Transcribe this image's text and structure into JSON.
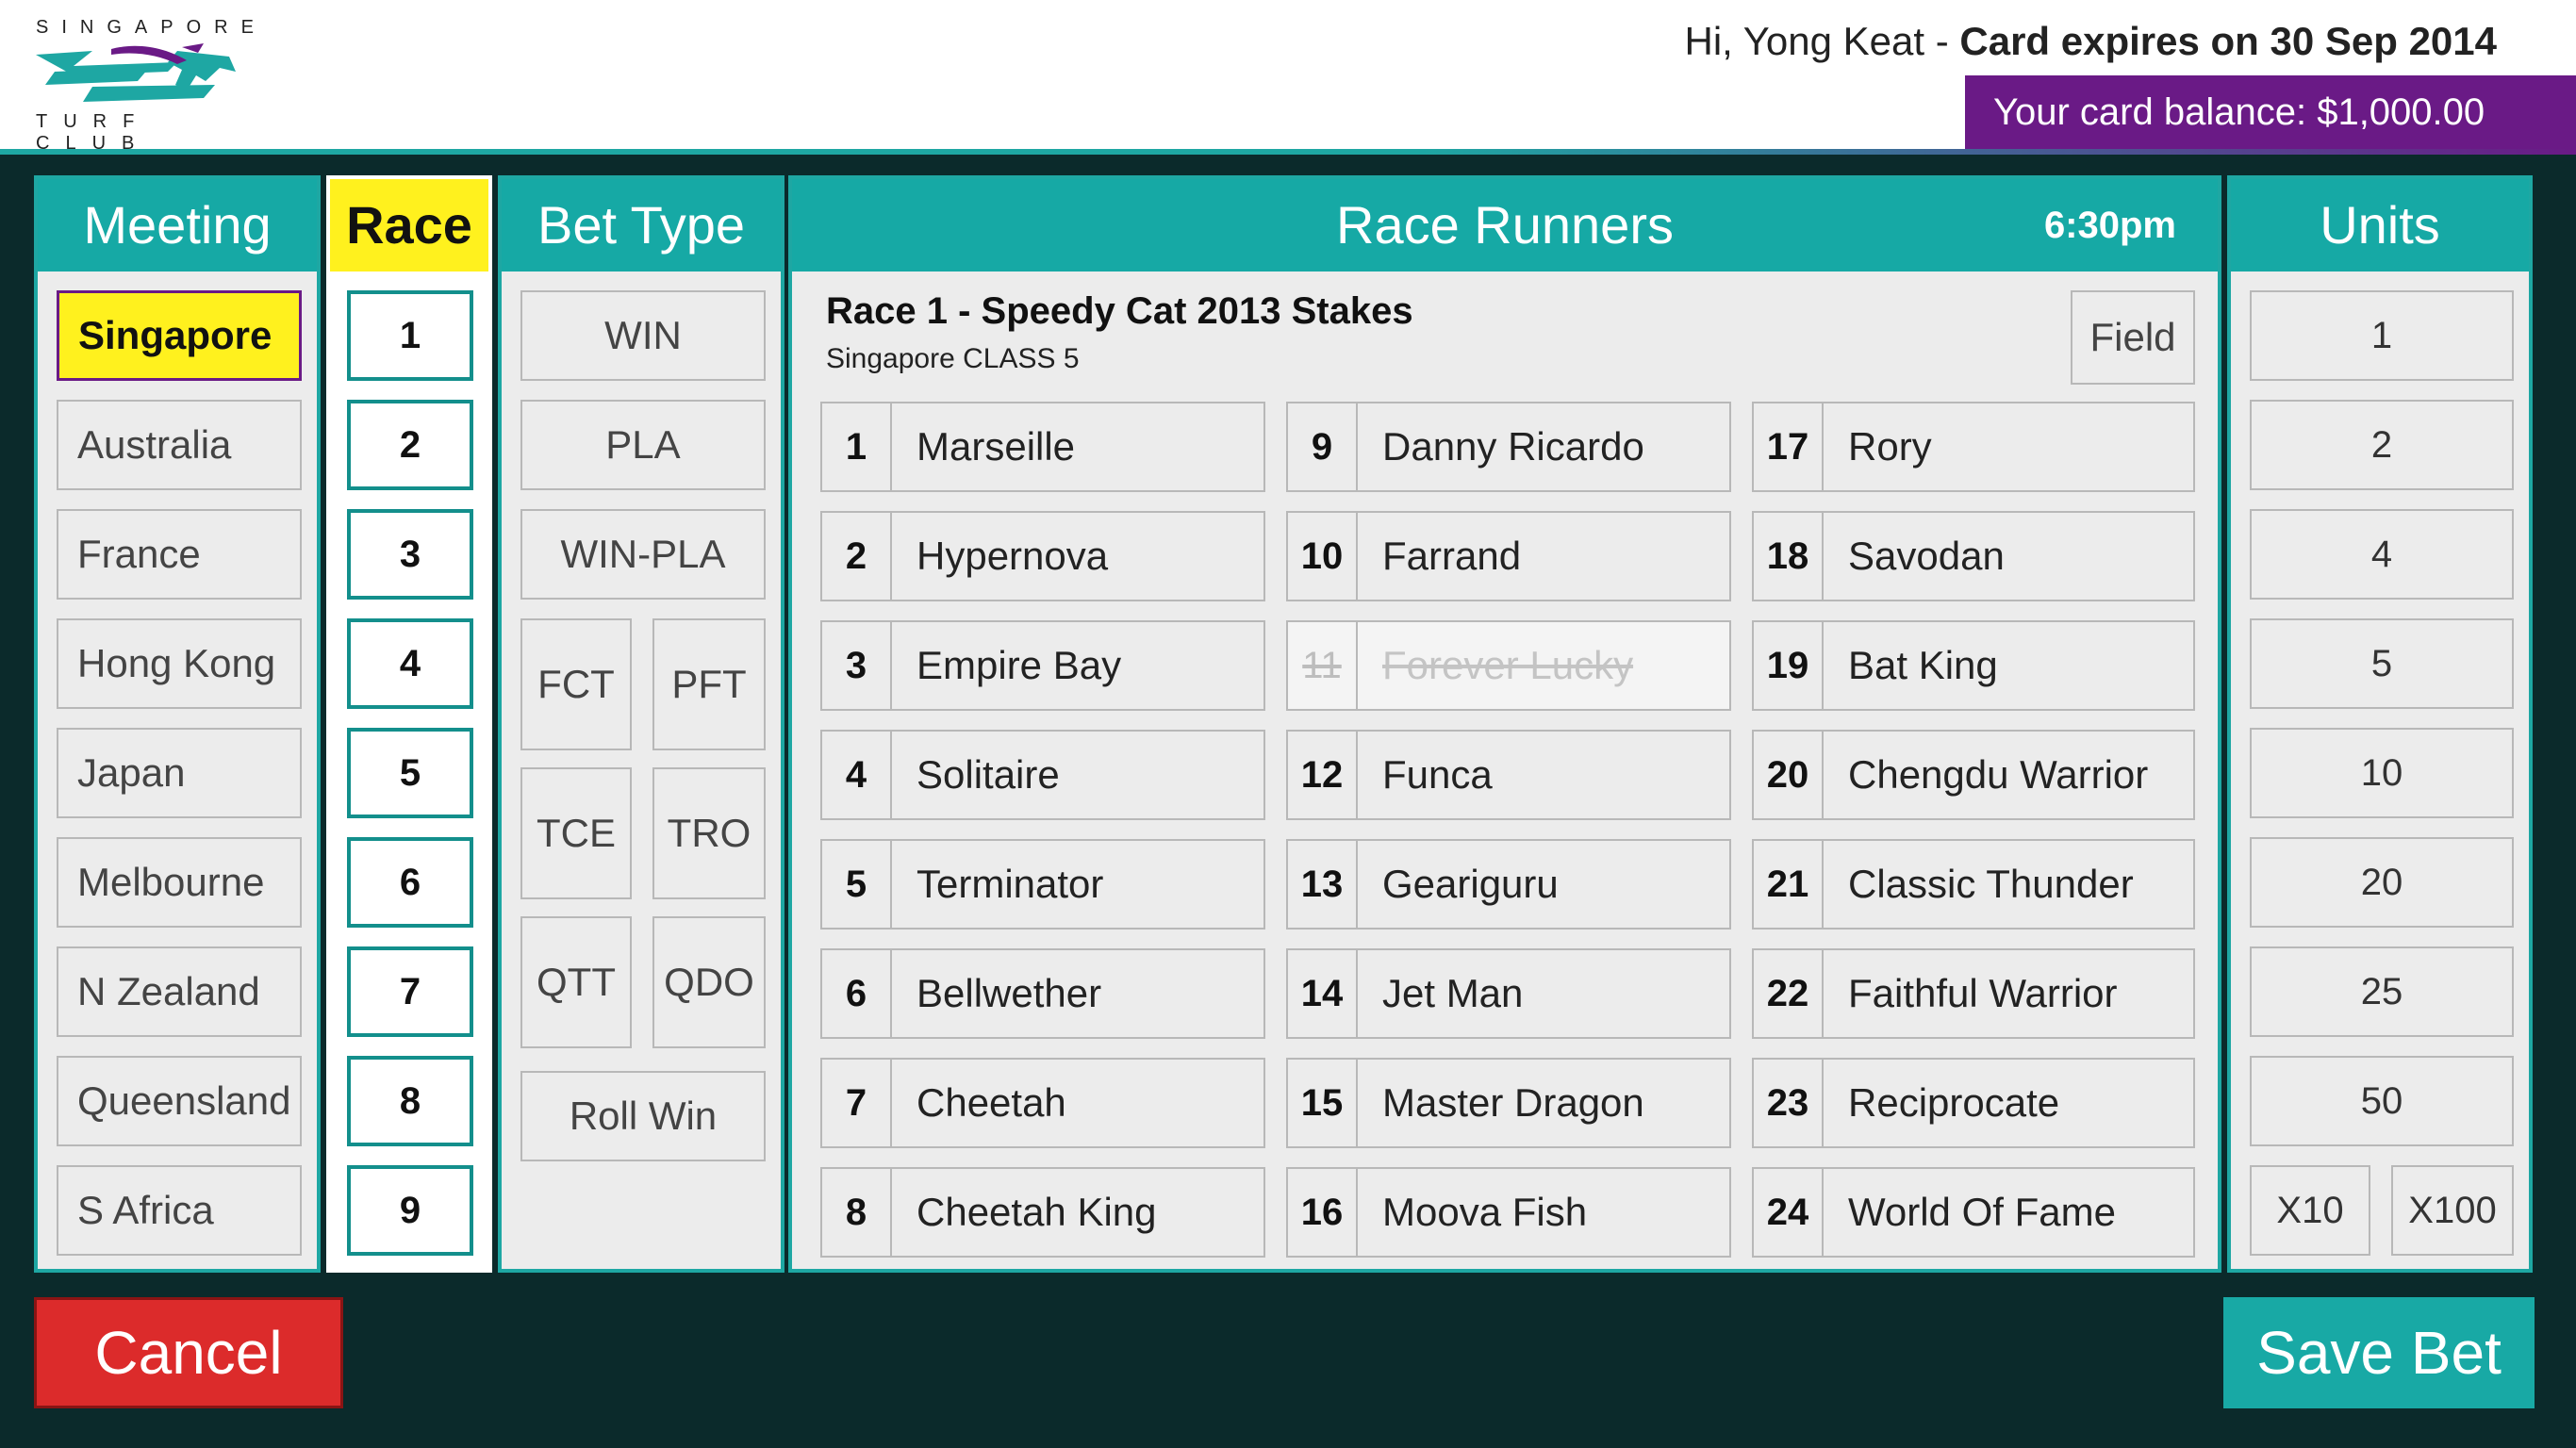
{
  "header": {
    "logo_top": "SINGAPORE",
    "logo_bottom": "TURF CLUB",
    "greeting": "Hi, Yong Keat - ",
    "card_expiry": "Card expires on 30 Sep 2014",
    "balance": "Your card balance: $1,000.00"
  },
  "meeting": {
    "title": "Meeting",
    "items": [
      "Singapore",
      "Australia",
      "France",
      "Hong Kong",
      "Japan",
      "Melbourne",
      "N Zealand",
      "Queensland",
      "S Africa"
    ],
    "selected": "Singapore"
  },
  "race": {
    "title": "Race",
    "items": [
      "1",
      "2",
      "3",
      "4",
      "5",
      "6",
      "7",
      "8",
      "9"
    ]
  },
  "bet_type": {
    "title": "Bet Type",
    "win": "WIN",
    "pla": "PLA",
    "win_pla": "WIN-PLA",
    "fct": "FCT",
    "pft": "PFT",
    "tce": "TCE",
    "tro": "TRO",
    "qtt": "QTT",
    "qdo": "QDO",
    "roll_win": "Roll Win"
  },
  "runners": {
    "title": "Race Runners",
    "time": "6:30pm",
    "race_name": "Race 1 - Speedy Cat 2013 Stakes",
    "race_class": "Singapore CLASS 5",
    "field_label": "Field",
    "items": [
      {
        "num": "1",
        "name": "Marseille"
      },
      {
        "num": "2",
        "name": "Hypernova"
      },
      {
        "num": "3",
        "name": "Empire Bay"
      },
      {
        "num": "4",
        "name": "Solitaire"
      },
      {
        "num": "5",
        "name": "Terminator"
      },
      {
        "num": "6",
        "name": "Bellwether"
      },
      {
        "num": "7",
        "name": "Cheetah"
      },
      {
        "num": "8",
        "name": "Cheetah King"
      },
      {
        "num": "9",
        "name": "Danny Ricardo"
      },
      {
        "num": "10",
        "name": "Farrand"
      },
      {
        "num": "11",
        "name": "Forever Lucky",
        "scratched": true
      },
      {
        "num": "12",
        "name": "Funca"
      },
      {
        "num": "13",
        "name": "Geariguru"
      },
      {
        "num": "14",
        "name": "Jet Man"
      },
      {
        "num": "15",
        "name": "Master Dragon"
      },
      {
        "num": "16",
        "name": "Moova Fish"
      },
      {
        "num": "17",
        "name": "Rory"
      },
      {
        "num": "18",
        "name": "Savodan"
      },
      {
        "num": "19",
        "name": "Bat King"
      },
      {
        "num": "20",
        "name": "Chengdu Warrior"
      },
      {
        "num": "21",
        "name": "Classic Thunder"
      },
      {
        "num": "22",
        "name": "Faithful Warrior"
      },
      {
        "num": "23",
        "name": "Reciprocate"
      },
      {
        "num": "24",
        "name": "World Of Fame"
      }
    ]
  },
  "units": {
    "title": "Units",
    "items": [
      "1",
      "2",
      "4",
      "5",
      "10",
      "20",
      "25",
      "50"
    ],
    "x10": "X10",
    "x100": "X100"
  },
  "actions": {
    "cancel": "Cancel",
    "save": "Save Bet"
  },
  "colors": {
    "teal": "#16a9a5",
    "yellow": "#fff11e",
    "purple": "#6a1a86",
    "red": "#dc2b2b",
    "background": "#0b2a2b"
  }
}
